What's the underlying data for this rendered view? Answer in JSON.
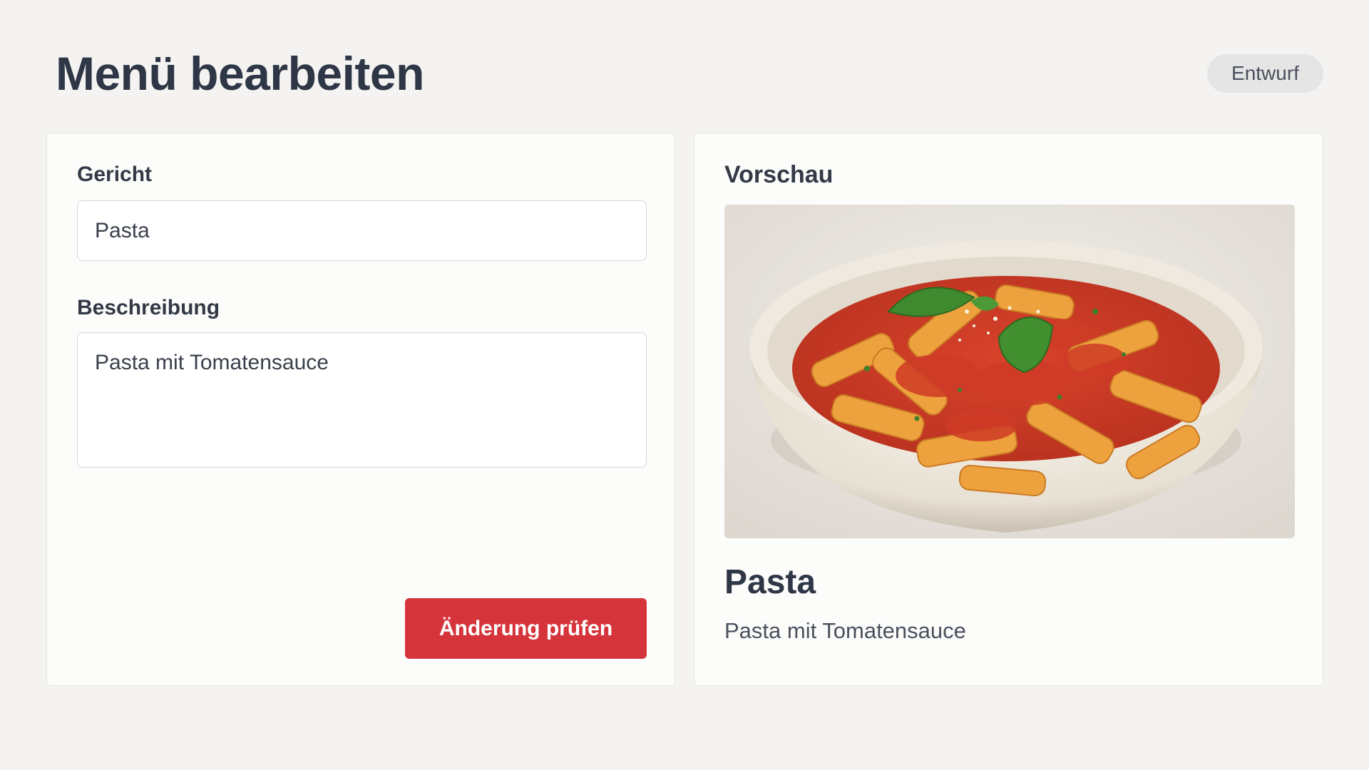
{
  "page": {
    "title": "Menü bearbeiten",
    "status": "Entwurf"
  },
  "form": {
    "dish_label": "Gericht",
    "dish_value": "Pasta",
    "description_label": "Beschreibung",
    "description_value": "Pasta mit Tomatensauce",
    "submit_label": "Änderung prüfen"
  },
  "preview": {
    "heading": "Vorschau",
    "image_name": "pasta-dish-photo",
    "title": "Pasta",
    "description": "Pasta mit Tomatensauce"
  },
  "colors": {
    "background": "#f4f3f1",
    "card": "#fcfcfb",
    "primary_button": "#d6343b",
    "badge": "#e5e5e5",
    "heading_text": "#2f3747"
  }
}
